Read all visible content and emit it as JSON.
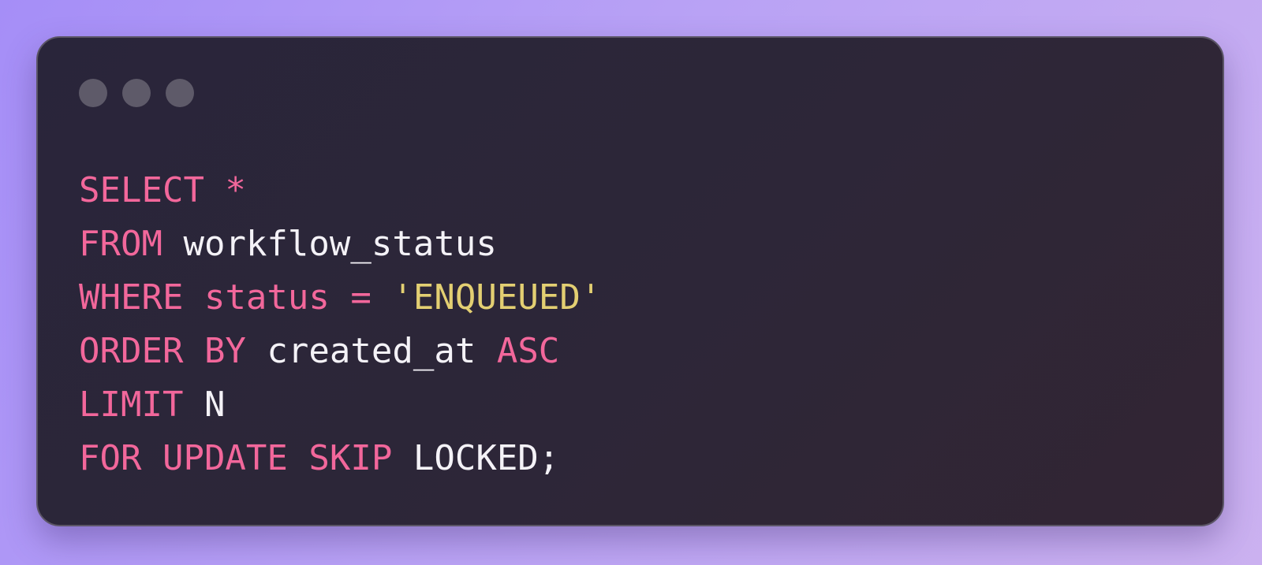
{
  "window": {
    "controls": [
      "close-dot",
      "minimize-dot",
      "maximize-dot"
    ]
  },
  "code": {
    "lines": [
      {
        "keyword": "SELECT *"
      },
      {
        "keyword": "FROM",
        "ident": "workflow_status"
      },
      {
        "keyword": "WHERE",
        "column": "status",
        "operator": "=",
        "string": "'ENQUEUED'"
      },
      {
        "keyword": "ORDER BY",
        "ident": "created_at",
        "keyword2": "ASC"
      },
      {
        "keyword": "LIMIT",
        "ident": "N"
      },
      {
        "keyword": "FOR UPDATE SKIP",
        "ident": "LOCKED;"
      }
    ]
  },
  "colors": {
    "keyword": "#f2679b",
    "identifier": "#f4f2f7",
    "string": "#e3cf72",
    "card_background": "#2b2639",
    "page_gradient_start": "#a58ef7",
    "page_gradient_end": "#cbb1f0"
  }
}
